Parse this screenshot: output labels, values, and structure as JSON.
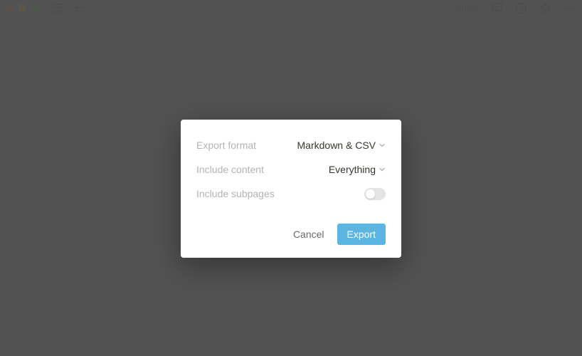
{
  "topbar": {
    "share_label": "Share"
  },
  "modal": {
    "rows": {
      "export_format": {
        "label": "Export format",
        "value": "Markdown & CSV"
      },
      "include_content": {
        "label": "Include content",
        "value": "Everything"
      },
      "include_subpages": {
        "label": "Include subpages",
        "toggle_on": false
      }
    },
    "footer": {
      "cancel_label": "Cancel",
      "export_label": "Export"
    }
  }
}
